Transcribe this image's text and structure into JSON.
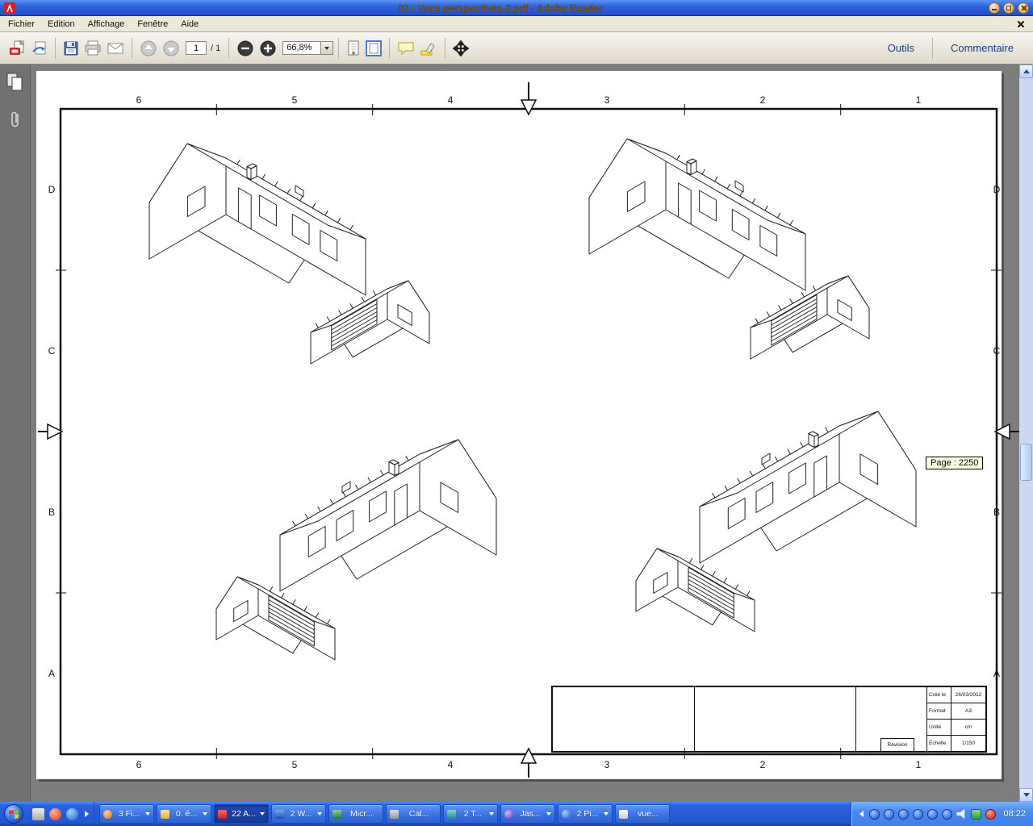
{
  "window": {
    "title": "02 - Vues perspectives-3.pdf - Adobe Reader"
  },
  "menubar": {
    "items": [
      "Fichier",
      "Edition",
      "Affichage",
      "Fenêtre",
      "Aide"
    ]
  },
  "toolbar": {
    "page_value": "1",
    "page_total": "/ 1",
    "zoom_value": "66,8%",
    "tools_label": "Outils",
    "comment_label": "Commentaire"
  },
  "page": {
    "grid_top": [
      "6",
      "5",
      "4",
      "3",
      "2",
      "1"
    ],
    "grid_bottom": [
      "6",
      "5",
      "4",
      "3",
      "2",
      "1"
    ],
    "grid_left": [
      "D",
      "C",
      "B",
      "A"
    ],
    "grid_right": [
      "D",
      "C",
      "B",
      "A"
    ],
    "scroll_tooltip": "Page : 2250",
    "titleblock": {
      "created_label": "Créé le",
      "created_value": "26/03/2012",
      "format_label": "Format",
      "format_value": "A3",
      "unit_label": "Unité",
      "unit_value": "cm",
      "scale_label": "Échelle",
      "scale_value": "1/150",
      "revision_label": "Révision"
    }
  },
  "taskbar": {
    "tasks": [
      {
        "label": "3 Fi...",
        "icon": "firefox-group-icon",
        "grouped": true
      },
      {
        "label": "0. é...",
        "icon": "folder-icon",
        "grouped": true
      },
      {
        "label": "22 A...",
        "icon": "adobe-reader-icon",
        "grouped": true,
        "active": true
      },
      {
        "label": "2 W...",
        "icon": "word-icon",
        "grouped": true
      },
      {
        "label": "Micr...",
        "icon": "excel-icon",
        "grouped": false
      },
      {
        "label": "Cal...",
        "icon": "calculator-icon",
        "grouped": false
      },
      {
        "label": "2 T...",
        "icon": "teal-app-icon",
        "grouped": true
      },
      {
        "label": "Jas...",
        "icon": "purple-app-icon",
        "grouped": true
      },
      {
        "label": "2 Pi...",
        "icon": "blue-app-icon",
        "grouped": true
      },
      {
        "label": "vue...",
        "icon": "document-icon",
        "grouped": false
      }
    ],
    "time": "08:22"
  },
  "colors": {
    "titlebar_blue": "#2f63dc",
    "title_text_brown": "#6e4a00",
    "taskbar_blue": "#2257d0",
    "toolbar_link_blue": "#17407f",
    "document_background_gray": "#7d7d7d",
    "tooltip_yellow": "#ffffe1"
  },
  "icons": [
    "adobe-reader-logo-icon",
    "create-pdf-icon",
    "share-icon",
    "save-icon",
    "print-icon",
    "email-icon",
    "previous-page-icon",
    "next-page-icon",
    "zoom-out-icon",
    "zoom-in-icon",
    "scroll-mode-icon",
    "fit-page-icon",
    "comment-bubble-icon",
    "highlight-text-icon",
    "fullscreen-icon",
    "page-thumbnails-icon",
    "attachments-icon",
    "close-icon",
    "minimize-icon",
    "maximize-icon",
    "start-orb-icon",
    "volume-icon",
    "clock-icon"
  ]
}
